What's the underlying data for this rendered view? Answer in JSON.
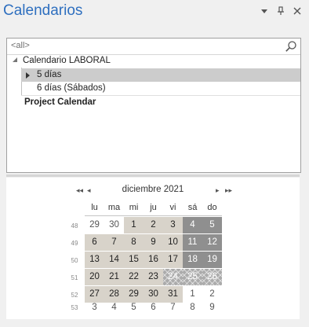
{
  "header": {
    "title": "Calendarios",
    "icons": [
      "dropdown-icon",
      "pin-icon",
      "close-icon"
    ]
  },
  "tree": {
    "filter_text": "<all>",
    "items": [
      {
        "label": "Calendario LABORAL",
        "level": 0,
        "expanded": true
      },
      {
        "label": "5 días",
        "level": 1,
        "selected": true
      },
      {
        "label": "6 días (Sábados)",
        "level": 1
      },
      {
        "label": "Project Calendar",
        "level": 0,
        "bold": true
      }
    ]
  },
  "calendar": {
    "month_label": "diciembre 2021",
    "nav": {
      "prev_year": "◂◂",
      "prev_month": "◂",
      "next_month": "▸",
      "next_year": "▸▸"
    },
    "weekdays": [
      "lu",
      "ma",
      "mi",
      "ju",
      "vi",
      "sá",
      "do"
    ],
    "weeks": [
      {
        "num": "48",
        "days": [
          "29",
          "30",
          "1",
          "2",
          "3",
          "4",
          "5"
        ]
      },
      {
        "num": "49",
        "days": [
          "6",
          "7",
          "8",
          "9",
          "10",
          "11",
          "12"
        ]
      },
      {
        "num": "50",
        "days": [
          "13",
          "14",
          "15",
          "16",
          "17",
          "18",
          "19"
        ]
      },
      {
        "num": "51",
        "days": [
          "20",
          "21",
          "22",
          "23",
          "24",
          "25",
          "26"
        ]
      },
      {
        "num": "52",
        "days": [
          "27",
          "28",
          "29",
          "30",
          "31",
          "1",
          "2"
        ]
      },
      {
        "num": "53",
        "days": [
          "3",
          "4",
          "5",
          "6",
          "7",
          "8",
          "9"
        ]
      }
    ],
    "colors": {
      "working": "#d8d3ca",
      "nonworking": "#8f8f8f",
      "exception": "#ababab"
    }
  }
}
